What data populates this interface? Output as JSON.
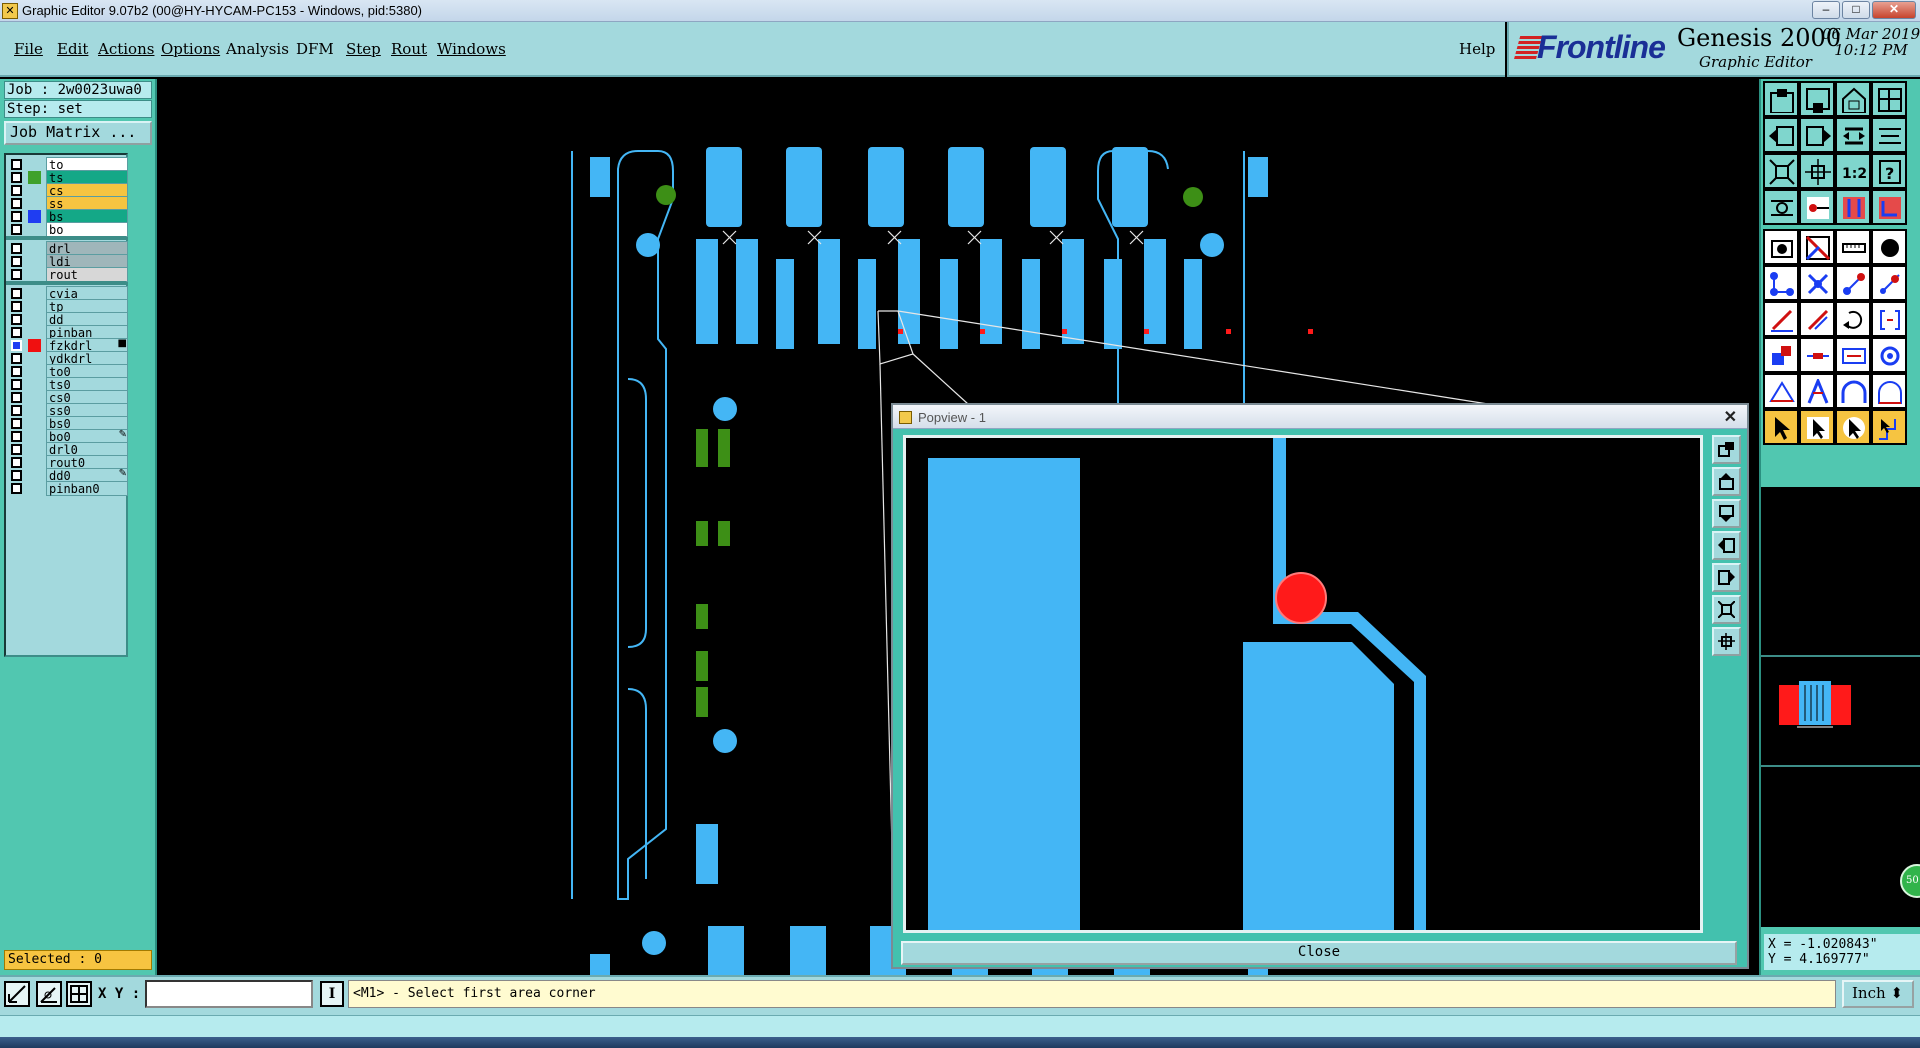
{
  "window": {
    "title": "Graphic Editor 9.07b2 (00@HY-HYCAM-PC153 - Windows, pid:5380)",
    "controls": [
      "–",
      "□",
      "✕"
    ]
  },
  "menubar": {
    "items": [
      {
        "label": "File"
      },
      {
        "label": "Edit"
      },
      {
        "label": "Actions"
      },
      {
        "label": "Options"
      },
      {
        "label": "Analysis"
      },
      {
        "label": "DFM"
      },
      {
        "label": "Step"
      },
      {
        "label": "Rout"
      },
      {
        "label": "Windows"
      }
    ],
    "help": "Help"
  },
  "logo": {
    "brand": "Frontline",
    "product": "Genesis 2000",
    "subtitle": "Graphic Editor",
    "date": "06 Mar 2019",
    "time": "10:12 PM"
  },
  "left_panel": {
    "job": "Job : 2w0023uwa0",
    "step": "Step: set",
    "job_matrix": "Job Matrix ...",
    "selected": "Selected : 0",
    "layers": [
      {
        "name": "to",
        "swatch": "",
        "bg": "#ffffff",
        "mark": ""
      },
      {
        "name": "ts",
        "swatch": "#3fa12b",
        "bg": "#14a887",
        "mark": ""
      },
      {
        "name": "cs",
        "swatch": "",
        "bg": "#f6c441",
        "mark": ""
      },
      {
        "name": "ss",
        "swatch": "",
        "bg": "#f6c441",
        "mark": ""
      },
      {
        "name": "bs",
        "swatch": "#1f3df2",
        "bg": "#14a887",
        "mark": ""
      },
      {
        "name": "bo",
        "swatch": "",
        "bg": "#ffffff",
        "mark": ""
      },
      {
        "name": "drl",
        "swatch": "",
        "bg": "#9fb6ba",
        "mark": ""
      },
      {
        "name": "ldi",
        "swatch": "",
        "bg": "#9fb6ba",
        "mark": ""
      },
      {
        "name": "rout",
        "swatch": "",
        "bg": "#d7d7d7",
        "mark": ""
      },
      {
        "name": "cvia",
        "swatch": "",
        "bg": "#a3d9dd",
        "mark": ""
      },
      {
        "name": "tp",
        "swatch": "",
        "bg": "#a3d9dd",
        "mark": ""
      },
      {
        "name": "dd",
        "swatch": "",
        "bg": "#a3d9dd",
        "mark": ""
      },
      {
        "name": "pinban",
        "swatch": "",
        "bg": "#a3d9dd",
        "mark": ""
      },
      {
        "name": "fzkdrl",
        "swatch": "#f01010",
        "bg": "#a3d9dd",
        "mark": "■"
      },
      {
        "name": "ydkdrl",
        "swatch": "",
        "bg": "#a3d9dd",
        "mark": ""
      },
      {
        "name": "to0",
        "swatch": "",
        "bg": "#a3d9dd",
        "mark": ""
      },
      {
        "name": "ts0",
        "swatch": "",
        "bg": "#a3d9dd",
        "mark": ""
      },
      {
        "name": "cs0",
        "swatch": "",
        "bg": "#a3d9dd",
        "mark": ""
      },
      {
        "name": "ss0",
        "swatch": "",
        "bg": "#a3d9dd",
        "mark": ""
      },
      {
        "name": "bs0",
        "swatch": "",
        "bg": "#a3d9dd",
        "mark": ""
      },
      {
        "name": "bo0",
        "swatch": "",
        "bg": "#a3d9dd",
        "mark": "✎"
      },
      {
        "name": "drl0",
        "swatch": "",
        "bg": "#a3d9dd",
        "mark": ""
      },
      {
        "name": "rout0",
        "swatch": "",
        "bg": "#a3d9dd",
        "mark": ""
      },
      {
        "name": "dd0",
        "swatch": "",
        "bg": "#a3d9dd",
        "mark": "✎"
      },
      {
        "name": "pinban0",
        "swatch": "",
        "bg": "#a3d9dd",
        "mark": ""
      }
    ]
  },
  "popview": {
    "title": "Popview - 1",
    "close_x": "✕",
    "close_button": "Close"
  },
  "right_panel": {
    "coord_x": "X = -1.020843\"",
    "coord_y": "Y = 4.169777\"",
    "ratio_tool": "1:2",
    "help_tool": "?",
    "bubble": "50"
  },
  "bottom_bar": {
    "xy_label": "X Y :",
    "xy_value": "",
    "info": "I",
    "prompt": "<M1> - Select first area corner",
    "unit": "Inch ⬍"
  },
  "colors": {
    "feature_blue": "#44b6f5",
    "panel_teal": "#51c7b0",
    "menu_bg": "#a3d9dd",
    "highlight_red": "#ff1a1a",
    "pad_green": "#3d8f16"
  }
}
